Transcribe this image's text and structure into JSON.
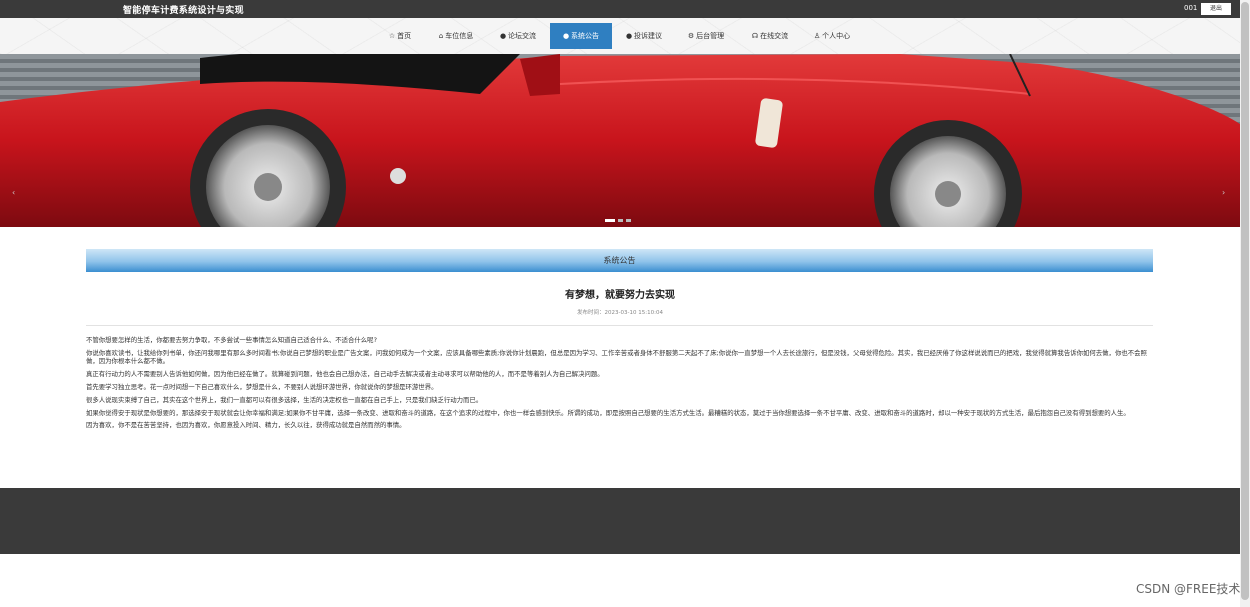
{
  "header": {
    "site_title": "智能停车计费系统设计与实现",
    "username": "001",
    "logout_label": "退出"
  },
  "nav": {
    "items": [
      {
        "label": "首页",
        "icon": "star-icon"
      },
      {
        "label": "车位信息",
        "icon": "lock-icon"
      },
      {
        "label": "论坛交流",
        "icon": "info-icon"
      },
      {
        "label": "系统公告",
        "icon": "info-icon",
        "active": true
      },
      {
        "label": "投诉建议",
        "icon": "info-icon"
      },
      {
        "label": "后台管理",
        "icon": "gear-icon"
      },
      {
        "label": "在线交流",
        "icon": "headset-icon"
      },
      {
        "label": "个人中心",
        "icon": "user-icon"
      }
    ]
  },
  "banner": {
    "prev_label": "‹",
    "next_label": "›",
    "slide_count": 3,
    "active_slide": 1
  },
  "section": {
    "title": "系统公告"
  },
  "article": {
    "title": "有梦想，就要努力去实现",
    "meta": "发布时间：2023-03-10 15:10:04",
    "paragraphs": [
      "不管你想要怎样的生活，你都要去努力争取，不多尝试一些事情怎么知道自己适合什么、不适合什么呢?",
      "你说你喜欢读书，让我给你列书单，你还问我哪里有那么多时间看书;你说自己梦想的职业是广告文案，问我如何成为一个文案，应该具备哪些素质;你说你计划晨跑，但总是因为学习、工作辛苦或者身体不舒服第二天起不了床;你说你一直梦想一个人去长途旅行，但是没钱，父母觉得危险。其实，我已经厌倦了你这样说说而已的把戏，我觉得就算我告诉你如何去做，你也不会照做，因为你根本什么都不做。",
      "真正有行动力的人不需要别人告诉他如何做，因为他已经在做了。就算碰到问题，他也会自己想办法，自己动手去解决或者主动寻求可以帮助他的人，而不是等着别人为自己解决问题。",
      "首先要学习独立思考。花一点时间想一下自己喜欢什么，梦想是什么，不要别人说想环游世界，你就说你的梦想是环游世界。",
      "很多人说现实束缚了自己，其实在这个世界上，我们一直都可以有很多选择，生活的决定权也一直都在自己手上，只是我们缺乏行动力而已。",
      "如果你觉得安于现状是你想要的，那选择安于现状就会让你幸福和满足;如果你不甘平庸，选择一条改变、进取和奋斗的道路，在这个追求的过程中，你也一样会感到快乐。所谓的成功，即是按照自己想要的生活方式生活。最糟糕的状态，莫过于当你想要选择一条不甘平庸、改变、进取和奋斗的道路时，却以一种安于现状的方式生活，最后抱怨自己没有得到想要的人生。",
      "因为喜欢，你不是在苦苦坚持，也因为喜欢，你愿意投入时间、精力，长久以往，获得成功就是自然而然的事情。"
    ]
  },
  "watermark": "CSDN @FREE技术",
  "colors": {
    "topbar": "#3a3a3a",
    "nav_active": "#2f7fc1",
    "section_header": "#3b8fd0",
    "car_body": "#c8141c"
  }
}
